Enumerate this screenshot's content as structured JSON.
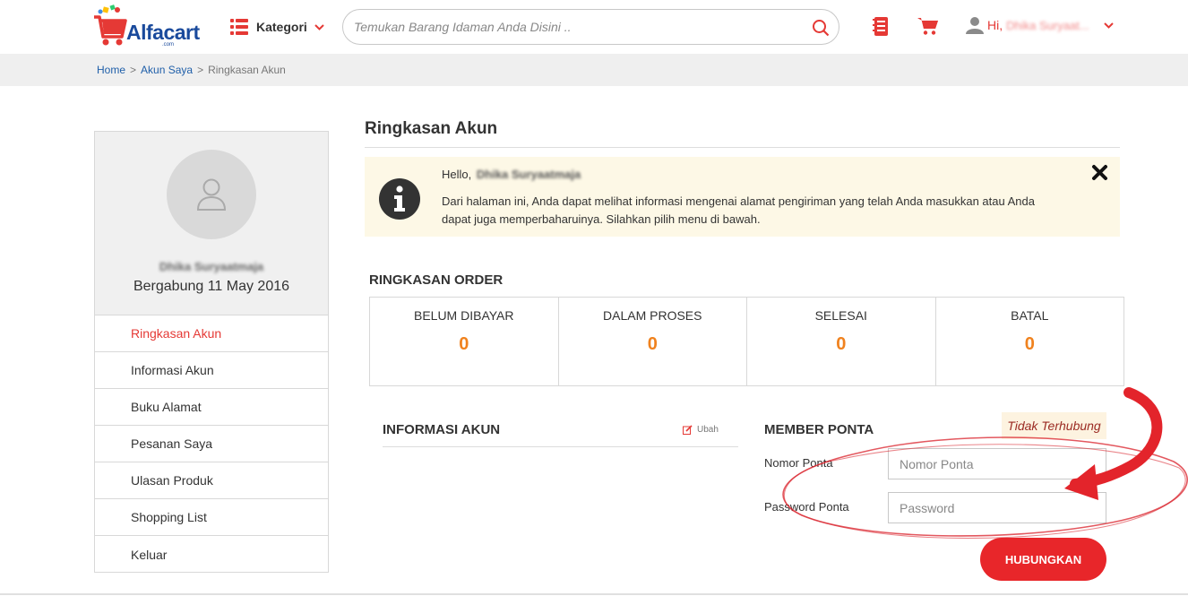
{
  "header": {
    "logo_text": "Alfacart",
    "logo_sub": ".com",
    "kategori_label": "Kategori",
    "search_placeholder": "Temukan Barang Idaman Anda Disini ..",
    "greeting": "Hi,",
    "username": "Dhika Suryaat...",
    "colors": {
      "accent": "#e53935",
      "brand_blue": "#1a4a9c"
    },
    "icons": [
      "menu-list-icon",
      "chevron-down-icon",
      "search-icon",
      "order-list-icon",
      "cart-icon",
      "user-icon"
    ]
  },
  "breadcrumb": {
    "home": "Home",
    "sep1": ">",
    "akun": "Akun Saya",
    "sep2": ">",
    "current": "Ringkasan Akun"
  },
  "sidebar": {
    "name": "Dhika Suryaatmaja",
    "joined": "Bergabung 11 May 2016",
    "items": [
      {
        "label": "Ringkasan Akun",
        "active": true
      },
      {
        "label": "Informasi Akun"
      },
      {
        "label": "Buku Alamat"
      },
      {
        "label": "Pesanan Saya"
      },
      {
        "label": "Ulasan Produk"
      },
      {
        "label": "Shopping List"
      },
      {
        "label": "Keluar"
      }
    ]
  },
  "main": {
    "title": "Ringkasan Akun",
    "notice": {
      "hello": "Hello,",
      "name": "Dhika Suryaatmaja",
      "text": "Dari halaman ini, Anda dapat melihat informasi mengenai alamat pengiriman yang telah Anda masukkan atau Anda dapat juga memperbaharuinya. Silahkan pilih menu di bawah."
    },
    "order_summary": {
      "title": "RINGKASAN ORDER",
      "cells": [
        {
          "label": "BELUM DIBAYAR",
          "value": "0"
        },
        {
          "label": "DALAM PROSES",
          "value": "0"
        },
        {
          "label": "SELESAI",
          "value": "0"
        },
        {
          "label": "BATAL",
          "value": "0"
        }
      ]
    },
    "account_info": {
      "title": "INFORMASI AKUN",
      "edit_label": "Ubah"
    },
    "member_ponta": {
      "title": "MEMBER PONTA",
      "status": "Tidak Terhubung",
      "number_label": "Nomor Ponta",
      "number_placeholder": "Nomor Ponta",
      "password_label": "Password Ponta",
      "password_placeholder": "Password",
      "connect_button": "HUBUNGKAN"
    }
  }
}
